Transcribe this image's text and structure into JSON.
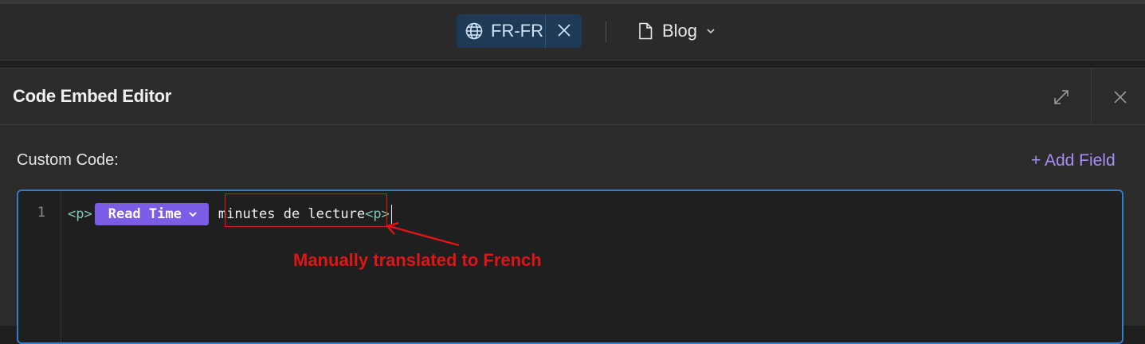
{
  "topbar": {
    "locale": {
      "label": "FR-FR",
      "icon": "globe-icon",
      "bg": "#1e3a57"
    },
    "page_selector": {
      "label": "Blog",
      "icon": "document-icon"
    }
  },
  "panel": {
    "title": "Code Embed Editor",
    "custom_code_label": "Custom Code:",
    "add_field_label": "+ Add Field"
  },
  "editor": {
    "line_number": "1",
    "open_tag": "<p>",
    "field_pill": {
      "label": "Read Time",
      "color": "#7b5ce6"
    },
    "text": "minutes de lecture",
    "close_tag": "<p>",
    "focus_border": "#2f7fd0"
  },
  "annotation": {
    "text": "Manually translated to French",
    "color": "#e01515"
  }
}
